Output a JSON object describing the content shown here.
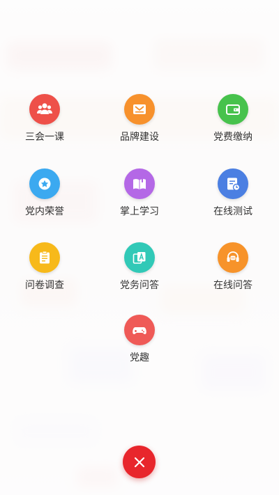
{
  "menu": {
    "items": [
      {
        "label": "三会一课",
        "color": "#ee5049",
        "icon": "people-group-icon"
      },
      {
        "label": "品牌建设",
        "color": "#f7912c",
        "icon": "brand-badge-icon"
      },
      {
        "label": "党费缴纳",
        "color": "#47c24c",
        "icon": "wallet-icon"
      },
      {
        "label": "党内荣誉",
        "color": "#3ba9f0",
        "icon": "star-medal-icon"
      },
      {
        "label": "掌上学习",
        "color": "#b468e6",
        "icon": "book-icon"
      },
      {
        "label": "在线测试",
        "color": "#4b7fe2",
        "icon": "document-clock-icon"
      },
      {
        "label": "问卷调查",
        "color": "#f7b91a",
        "icon": "clipboard-icon"
      },
      {
        "label": "党务问答",
        "color": "#31c9b7",
        "icon": "qa-cards-icon"
      },
      {
        "label": "在线问答",
        "color": "#f7932a",
        "icon": "headset-icon"
      },
      {
        "label": "党趣",
        "color": "#ef5a57",
        "icon": "gamepad-icon"
      }
    ]
  },
  "close_button": {
    "icon": "close-icon",
    "color": "#e8262c"
  }
}
